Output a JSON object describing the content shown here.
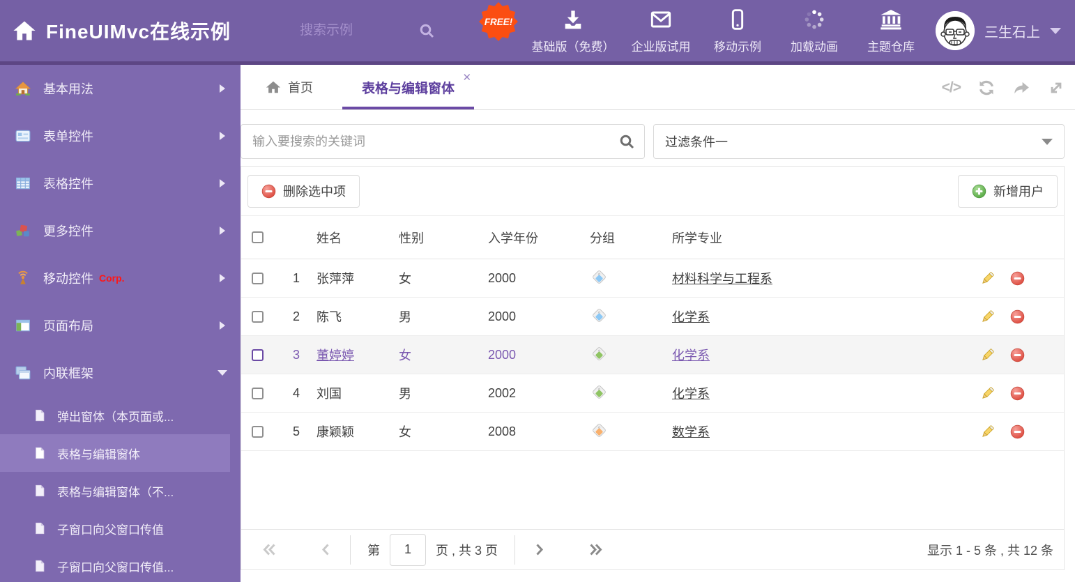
{
  "colors": {
    "header_bg": "#7560A5",
    "header_strip": "#5D4684",
    "sidebar_bg": "#7E69AF",
    "sidebar_active_bg": "#8F7BBE",
    "accent_purple": "#6B4AA5",
    "selected_text": "#7A58B0",
    "free_badge_bg": "#FB4E12",
    "delete_red": "#DC4A3E",
    "add_green": "#57A944",
    "link_color": "#3F3F3F"
  },
  "icons": {
    "code_glyph": "</>",
    "close_glyph": "✕"
  },
  "header": {
    "title": "FineUIMvc在线示例",
    "search_placeholder": "搜索示例",
    "free_badge": "FREE!",
    "nav": [
      {
        "label": "基础版（免费）"
      },
      {
        "label": "企业版试用"
      },
      {
        "label": "移动示例"
      },
      {
        "label": "加载动画"
      },
      {
        "label": "主题仓库"
      }
    ],
    "username": "三生石上"
  },
  "sidebar": {
    "items": [
      {
        "label": "基本用法"
      },
      {
        "label": "表单控件"
      },
      {
        "label": "表格控件"
      },
      {
        "label": "更多控件"
      },
      {
        "label": "移动控件",
        "badge": "Corp."
      },
      {
        "label": "页面布局"
      },
      {
        "label": "内联框架"
      }
    ],
    "subitems": [
      {
        "label": "弹出窗体（本页面或..."
      },
      {
        "label": "表格与编辑窗体"
      },
      {
        "label": "表格与编辑窗体（不..."
      },
      {
        "label": "子窗口向父窗口传值"
      },
      {
        "label": "子窗口向父窗口传值..."
      }
    ]
  },
  "tabs": {
    "home": "首页",
    "active": "表格与编辑窗体"
  },
  "filters": {
    "search_placeholder": "输入要搜索的关键词",
    "filter_value": "过滤条件一"
  },
  "actions": {
    "delete": "删除选中项",
    "add": "新增用户"
  },
  "table": {
    "columns": {
      "name": "姓名",
      "gender": "性别",
      "year": "入学年份",
      "group": "分组",
      "major": "所学专业"
    },
    "rows": [
      {
        "num": "1",
        "name": "张萍萍",
        "gender": "女",
        "year": "2000",
        "tag_color": "#8CC8F5",
        "major": "材料科学与工程系"
      },
      {
        "num": "2",
        "name": "陈飞",
        "gender": "男",
        "year": "2000",
        "tag_color": "#8CC8F5",
        "major": "化学系"
      },
      {
        "num": "3",
        "name": "董婷婷",
        "gender": "女",
        "year": "2000",
        "tag_color": "#8FC463",
        "major": "化学系"
      },
      {
        "num": "4",
        "name": "刘国",
        "gender": "男",
        "year": "2002",
        "tag_color": "#8FC463",
        "major": "化学系"
      },
      {
        "num": "5",
        "name": "康颖颖",
        "gender": "女",
        "year": "2008",
        "tag_color": "#F9B06C",
        "major": "数学系"
      }
    ]
  },
  "pagination": {
    "page_prefix": "第",
    "page_value": "1",
    "page_suffix": "页 , 共 3 页",
    "summary": "显示 1 - 5 条 , 共 12 条"
  }
}
